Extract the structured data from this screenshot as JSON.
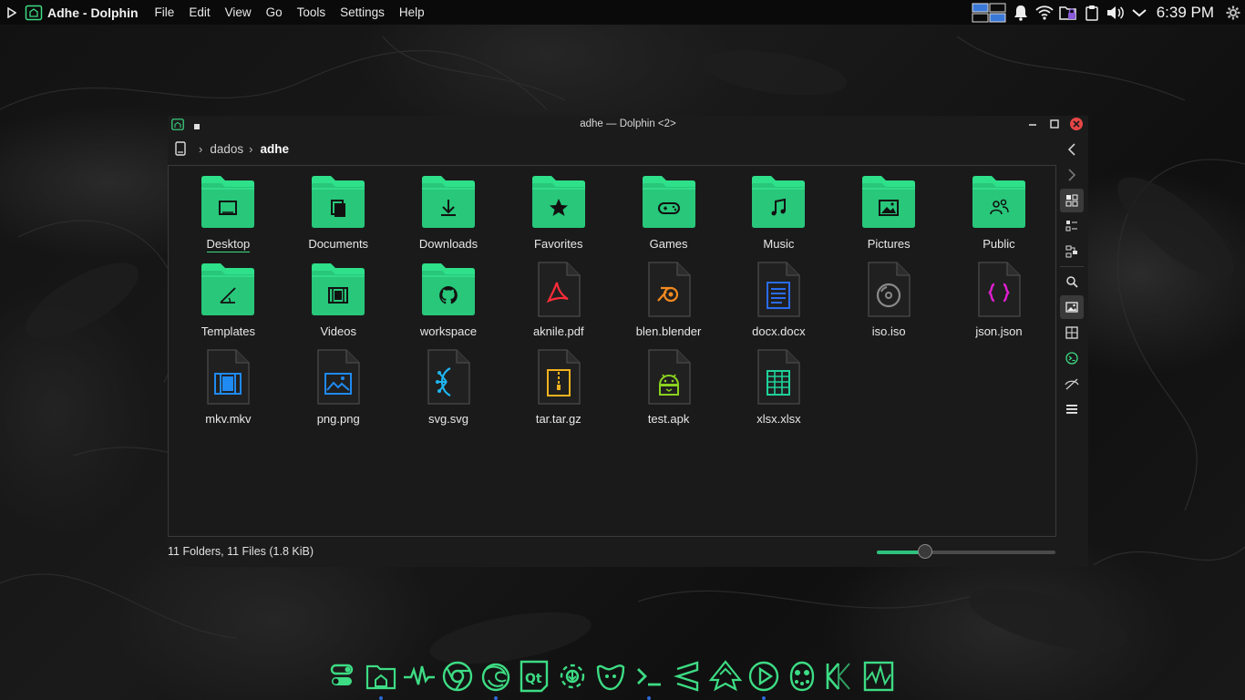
{
  "topbar": {
    "app_title": "Adhe - Dolphin",
    "menu": [
      "File",
      "Edit",
      "View",
      "Go",
      "Tools",
      "Settings",
      "Help"
    ],
    "clock": "6:39 PM",
    "tray_icons": [
      "task-manager-icon",
      "notifications-icon",
      "wifi-icon",
      "folder-lock-icon",
      "clipboard-icon",
      "volume-icon",
      "chevron-down-icon"
    ]
  },
  "window": {
    "title": "adhe — Dolphin <2>",
    "breadcrumb": [
      "dados",
      "adhe"
    ],
    "items": [
      {
        "label": "Desktop",
        "kind": "folder",
        "glyph": "desktop"
      },
      {
        "label": "Documents",
        "kind": "folder",
        "glyph": "documents"
      },
      {
        "label": "Downloads",
        "kind": "folder",
        "glyph": "downloads"
      },
      {
        "label": "Favorites",
        "kind": "folder",
        "glyph": "star"
      },
      {
        "label": "Games",
        "kind": "folder",
        "glyph": "gamepad"
      },
      {
        "label": "Music",
        "kind": "folder",
        "glyph": "music"
      },
      {
        "label": "Pictures",
        "kind": "folder",
        "glyph": "picture"
      },
      {
        "label": "Public",
        "kind": "folder",
        "glyph": "people"
      },
      {
        "label": "Templates",
        "kind": "folder",
        "glyph": "template"
      },
      {
        "label": "Videos",
        "kind": "folder",
        "glyph": "film"
      },
      {
        "label": "workspace",
        "kind": "folder",
        "glyph": "github"
      },
      {
        "label": "aknile.pdf",
        "kind": "file",
        "glyph": "pdf",
        "color": "#ff2d3a"
      },
      {
        "label": "blen.blender",
        "kind": "file",
        "glyph": "blender",
        "color": "#f28a1f"
      },
      {
        "label": "docx.docx",
        "kind": "file",
        "glyph": "doc",
        "color": "#2a6cf0"
      },
      {
        "label": "iso.iso",
        "kind": "file",
        "glyph": "disc",
        "color": "#8a8a8a"
      },
      {
        "label": "json.json",
        "kind": "file",
        "glyph": "json",
        "color": "#e01fd0"
      },
      {
        "label": "mkv.mkv",
        "kind": "file",
        "glyph": "video",
        "color": "#1f8af2"
      },
      {
        "label": "png.png",
        "kind": "file",
        "glyph": "image",
        "color": "#1f8af2"
      },
      {
        "label": "svg.svg",
        "kind": "file",
        "glyph": "vector",
        "color": "#1fb6f2"
      },
      {
        "label": "tar.tar.gz",
        "kind": "file",
        "glyph": "archive",
        "color": "#f2b21f"
      },
      {
        "label": "test.apk",
        "kind": "file",
        "glyph": "android",
        "color": "#8ad21f"
      },
      {
        "label": "xlsx.xlsx",
        "kind": "file",
        "glyph": "sheet",
        "color": "#1fd29a"
      }
    ],
    "status": "11 Folders, 11 Files (1.8 KiB)",
    "zoom_fraction": 0.27
  },
  "colors": {
    "accent": "#3ddc84",
    "folder_top": "#2fe08a",
    "folder_body": "#28c77a",
    "close": "#e64646"
  },
  "dock_icons": [
    "toggle-icon",
    "home-folder-icon",
    "system-monitor-icon",
    "chrome-icon",
    "firefox-icon",
    "qt-creator-icon",
    "settings-gear-icon",
    "gimp-icon",
    "terminal-icon",
    "sublime-icon",
    "inkscape-icon",
    "media-player-icon",
    "pacman-icon",
    "kdenlive-icon",
    "ksysguard-icon"
  ]
}
